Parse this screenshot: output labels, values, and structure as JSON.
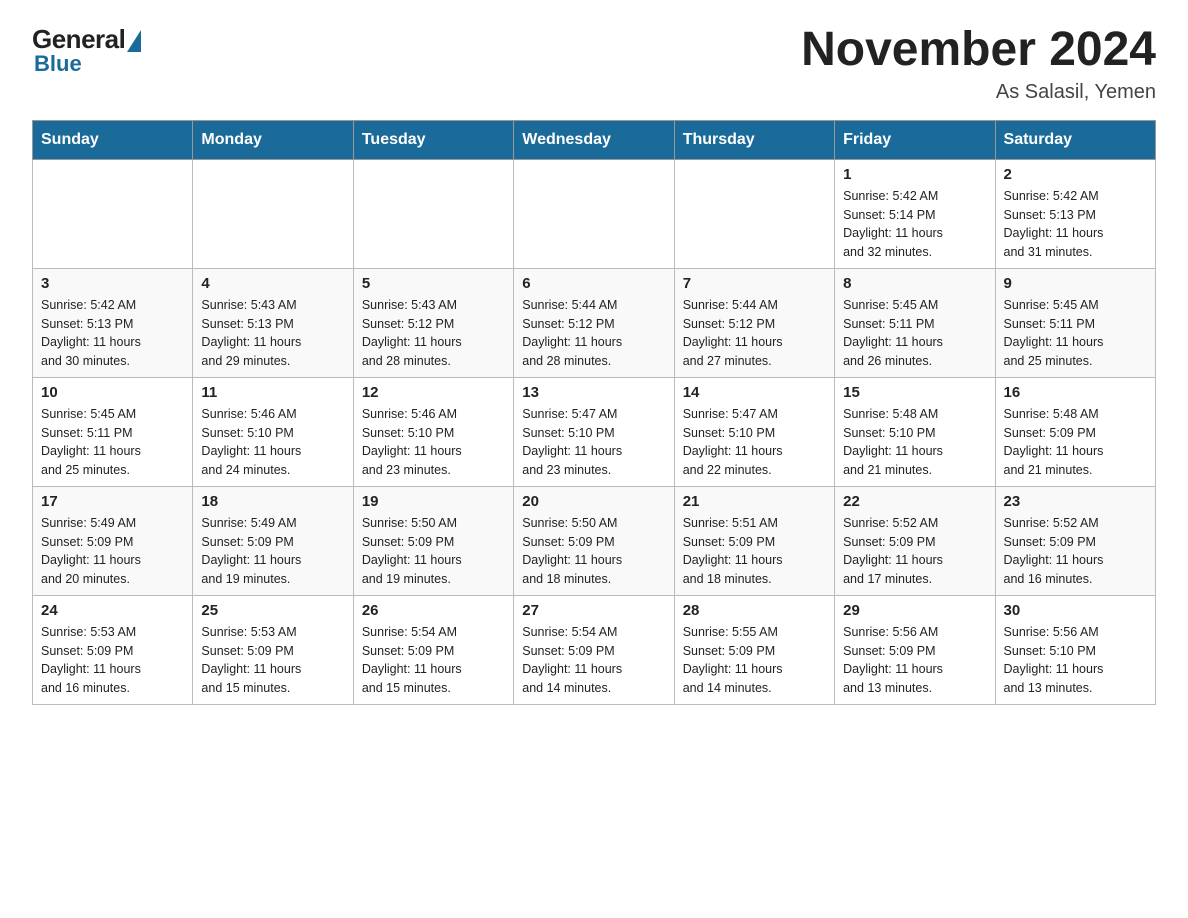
{
  "logo": {
    "general": "General",
    "blue": "Blue"
  },
  "title": "November 2024",
  "location": "As Salasil, Yemen",
  "weekdays": [
    "Sunday",
    "Monday",
    "Tuesday",
    "Wednesday",
    "Thursday",
    "Friday",
    "Saturday"
  ],
  "weeks": [
    [
      {
        "day": "",
        "info": ""
      },
      {
        "day": "",
        "info": ""
      },
      {
        "day": "",
        "info": ""
      },
      {
        "day": "",
        "info": ""
      },
      {
        "day": "",
        "info": ""
      },
      {
        "day": "1",
        "info": "Sunrise: 5:42 AM\nSunset: 5:14 PM\nDaylight: 11 hours\nand 32 minutes."
      },
      {
        "day": "2",
        "info": "Sunrise: 5:42 AM\nSunset: 5:13 PM\nDaylight: 11 hours\nand 31 minutes."
      }
    ],
    [
      {
        "day": "3",
        "info": "Sunrise: 5:42 AM\nSunset: 5:13 PM\nDaylight: 11 hours\nand 30 minutes."
      },
      {
        "day": "4",
        "info": "Sunrise: 5:43 AM\nSunset: 5:13 PM\nDaylight: 11 hours\nand 29 minutes."
      },
      {
        "day": "5",
        "info": "Sunrise: 5:43 AM\nSunset: 5:12 PM\nDaylight: 11 hours\nand 28 minutes."
      },
      {
        "day": "6",
        "info": "Sunrise: 5:44 AM\nSunset: 5:12 PM\nDaylight: 11 hours\nand 28 minutes."
      },
      {
        "day": "7",
        "info": "Sunrise: 5:44 AM\nSunset: 5:12 PM\nDaylight: 11 hours\nand 27 minutes."
      },
      {
        "day": "8",
        "info": "Sunrise: 5:45 AM\nSunset: 5:11 PM\nDaylight: 11 hours\nand 26 minutes."
      },
      {
        "day": "9",
        "info": "Sunrise: 5:45 AM\nSunset: 5:11 PM\nDaylight: 11 hours\nand 25 minutes."
      }
    ],
    [
      {
        "day": "10",
        "info": "Sunrise: 5:45 AM\nSunset: 5:11 PM\nDaylight: 11 hours\nand 25 minutes."
      },
      {
        "day": "11",
        "info": "Sunrise: 5:46 AM\nSunset: 5:10 PM\nDaylight: 11 hours\nand 24 minutes."
      },
      {
        "day": "12",
        "info": "Sunrise: 5:46 AM\nSunset: 5:10 PM\nDaylight: 11 hours\nand 23 minutes."
      },
      {
        "day": "13",
        "info": "Sunrise: 5:47 AM\nSunset: 5:10 PM\nDaylight: 11 hours\nand 23 minutes."
      },
      {
        "day": "14",
        "info": "Sunrise: 5:47 AM\nSunset: 5:10 PM\nDaylight: 11 hours\nand 22 minutes."
      },
      {
        "day": "15",
        "info": "Sunrise: 5:48 AM\nSunset: 5:10 PM\nDaylight: 11 hours\nand 21 minutes."
      },
      {
        "day": "16",
        "info": "Sunrise: 5:48 AM\nSunset: 5:09 PM\nDaylight: 11 hours\nand 21 minutes."
      }
    ],
    [
      {
        "day": "17",
        "info": "Sunrise: 5:49 AM\nSunset: 5:09 PM\nDaylight: 11 hours\nand 20 minutes."
      },
      {
        "day": "18",
        "info": "Sunrise: 5:49 AM\nSunset: 5:09 PM\nDaylight: 11 hours\nand 19 minutes."
      },
      {
        "day": "19",
        "info": "Sunrise: 5:50 AM\nSunset: 5:09 PM\nDaylight: 11 hours\nand 19 minutes."
      },
      {
        "day": "20",
        "info": "Sunrise: 5:50 AM\nSunset: 5:09 PM\nDaylight: 11 hours\nand 18 minutes."
      },
      {
        "day": "21",
        "info": "Sunrise: 5:51 AM\nSunset: 5:09 PM\nDaylight: 11 hours\nand 18 minutes."
      },
      {
        "day": "22",
        "info": "Sunrise: 5:52 AM\nSunset: 5:09 PM\nDaylight: 11 hours\nand 17 minutes."
      },
      {
        "day": "23",
        "info": "Sunrise: 5:52 AM\nSunset: 5:09 PM\nDaylight: 11 hours\nand 16 minutes."
      }
    ],
    [
      {
        "day": "24",
        "info": "Sunrise: 5:53 AM\nSunset: 5:09 PM\nDaylight: 11 hours\nand 16 minutes."
      },
      {
        "day": "25",
        "info": "Sunrise: 5:53 AM\nSunset: 5:09 PM\nDaylight: 11 hours\nand 15 minutes."
      },
      {
        "day": "26",
        "info": "Sunrise: 5:54 AM\nSunset: 5:09 PM\nDaylight: 11 hours\nand 15 minutes."
      },
      {
        "day": "27",
        "info": "Sunrise: 5:54 AM\nSunset: 5:09 PM\nDaylight: 11 hours\nand 14 minutes."
      },
      {
        "day": "28",
        "info": "Sunrise: 5:55 AM\nSunset: 5:09 PM\nDaylight: 11 hours\nand 14 minutes."
      },
      {
        "day": "29",
        "info": "Sunrise: 5:56 AM\nSunset: 5:09 PM\nDaylight: 11 hours\nand 13 minutes."
      },
      {
        "day": "30",
        "info": "Sunrise: 5:56 AM\nSunset: 5:10 PM\nDaylight: 11 hours\nand 13 minutes."
      }
    ]
  ]
}
